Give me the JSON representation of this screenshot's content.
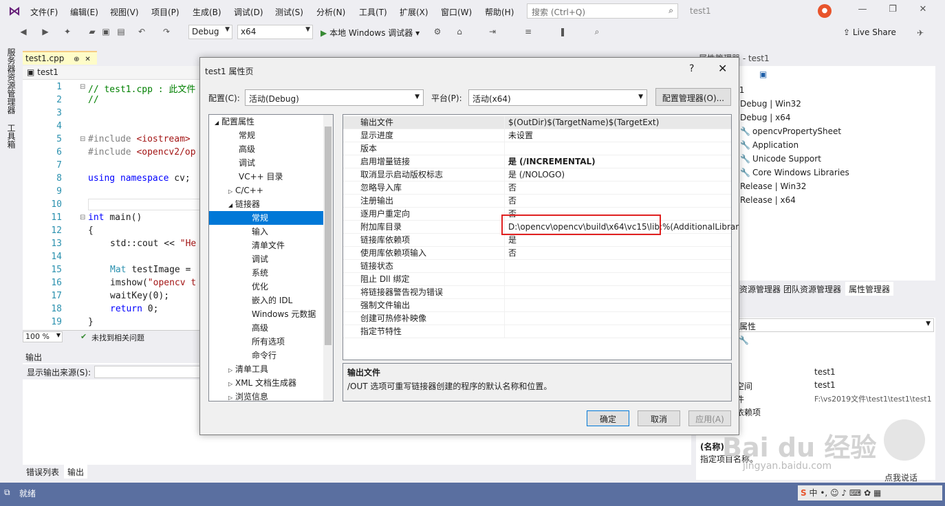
{
  "menubar": {
    "items": [
      "文件(F)",
      "编辑(E)",
      "视图(V)",
      "项目(P)",
      "生成(B)",
      "调试(D)",
      "测试(S)",
      "分析(N)",
      "工具(T)",
      "扩展(X)",
      "窗口(W)",
      "帮助(H)"
    ],
    "search_placeholder": "搜索 (Ctrl+Q)",
    "project_title": "test1"
  },
  "toolbar": {
    "config": "Debug",
    "platform": "x64",
    "run_label": "本地 Windows 调试器",
    "live_share": "Live Share"
  },
  "left_strip": {
    "tab1": "服务器资源管理器",
    "tab2": "工具箱"
  },
  "editor": {
    "tab_label": "test1.cpp",
    "breadcrumb": "test1",
    "line_numbers": [
      "1",
      "2",
      "3",
      "4",
      "5",
      "6",
      "7",
      "8",
      "9",
      "10",
      "11",
      "12",
      "13",
      "14",
      "15",
      "16",
      "17",
      "18",
      "19"
    ],
    "lines": {
      "l1_cm": "// test1.cpp : 此文件",
      "l2_cm": "//",
      "l5_kw": "#include",
      "l5_str": "<iostream>",
      "l6_kw": "#include",
      "l6_str": "<opencv2/op",
      "l8_kw1": "using",
      "l8_kw2": "namespace",
      "l8_rest": "cv;",
      "l11_kw": "int",
      "l11_rest": "main()",
      "l12": "{",
      "l13_a": "std::cout",
      "l13_b": "<<",
      "l13_str": "\"He",
      "l15_ty": "Mat",
      "l15_rest": "testImage =",
      "l16_fn": "imshow(",
      "l16_str": "\"opencv t",
      "l17": "waitKey(0);",
      "l18_kw": "return",
      "l18_rest": "0;",
      "l19": "}"
    },
    "zoom": "100 %",
    "issues": "未找到相关问题"
  },
  "output": {
    "title": "输出",
    "source_label": "显示输出来源(S):",
    "tabs": [
      "错误列表",
      "输出"
    ]
  },
  "prop_manager": {
    "title": "属性管理器 - test1",
    "tree_root": "t1",
    "tree": [
      "Debug | Win32",
      "Debug | x64",
      "opencvPropertySheet",
      "Application",
      "Unicode Support",
      "Core Windows Libraries",
      "Release | Win32",
      "Release | x64"
    ],
    "tabs": [
      "资源管理器",
      "团队资源管理器",
      "属性管理器"
    ]
  },
  "properties_panel": {
    "header": "属性",
    "rows": [
      {
        "name": "",
        "value": "test1"
      },
      {
        "name": "空间",
        "value": "test1"
      },
      {
        "name": "件",
        "value": "F:\\vs2019文件\\test1\\test1\\test1"
      },
      {
        "name": "依赖项",
        "value": ""
      }
    ],
    "desc_title": "(名称)",
    "desc_text": "指定项目名称。"
  },
  "dialog": {
    "title": "test1 属性页",
    "help": "?",
    "config_label": "配置(C):",
    "config_value": "活动(Debug)",
    "platform_label": "平台(P):",
    "platform_value": "活动(x64)",
    "config_manager": "配置管理器(O)...",
    "tree": [
      {
        "label": "配置属性",
        "expander": "◢"
      },
      {
        "label": "常规",
        "expander": ""
      },
      {
        "label": "高级",
        "expander": ""
      },
      {
        "label": "调试",
        "expander": ""
      },
      {
        "label": "VC++ 目录",
        "expander": ""
      },
      {
        "label": "C/C++",
        "expander": "▷"
      },
      {
        "label": "链接器",
        "expander": "◢"
      },
      {
        "label": "常规",
        "expander": ""
      },
      {
        "label": "输入",
        "expander": ""
      },
      {
        "label": "清单文件",
        "expander": ""
      },
      {
        "label": "调试",
        "expander": ""
      },
      {
        "label": "系统",
        "expander": ""
      },
      {
        "label": "优化",
        "expander": ""
      },
      {
        "label": "嵌入的 IDL",
        "expander": ""
      },
      {
        "label": "Windows 元数据",
        "expander": ""
      },
      {
        "label": "高级",
        "expander": ""
      },
      {
        "label": "所有选项",
        "expander": ""
      },
      {
        "label": "命令行",
        "expander": ""
      },
      {
        "label": "清单工具",
        "expander": "▷"
      },
      {
        "label": "XML 文档生成器",
        "expander": "▷"
      },
      {
        "label": "浏览信息",
        "expander": "▷"
      }
    ],
    "grid": [
      {
        "name": "输出文件",
        "value": "$(OutDir)$(TargetName)$(TargetExt)"
      },
      {
        "name": "显示进度",
        "value": "未设置"
      },
      {
        "name": "版本",
        "value": ""
      },
      {
        "name": "启用增量链接",
        "value": "是 (/INCREMENTAL)"
      },
      {
        "name": "取消显示启动版权标志",
        "value": "是 (/NOLOGO)"
      },
      {
        "name": "忽略导入库",
        "value": "否"
      },
      {
        "name": "注册输出",
        "value": "否"
      },
      {
        "name": "逐用户重定向",
        "value": "否"
      },
      {
        "name": "附加库目录",
        "value": "D:\\opencv\\opencv\\build\\x64\\vc15\\lib;%(AdditionalLibrar"
      },
      {
        "name": "链接库依赖项",
        "value": "是"
      },
      {
        "name": "使用库依赖项输入",
        "value": "否"
      },
      {
        "name": "链接状态",
        "value": ""
      },
      {
        "name": "阻止 Dll 绑定",
        "value": ""
      },
      {
        "name": "将链接器警告视为错误",
        "value": ""
      },
      {
        "name": "强制文件输出",
        "value": ""
      },
      {
        "name": "创建可热修补映像",
        "value": ""
      },
      {
        "name": "指定节特性",
        "value": ""
      }
    ],
    "desc_title": "输出文件",
    "desc_text": "/OUT 选项可重写链接器创建的程序的默认名称和位置。",
    "ok": "确定",
    "cancel": "取消",
    "apply": "应用(A)"
  },
  "statusbar": {
    "text": "就绪"
  },
  "watermark": {
    "logo": "Bai du 经验",
    "url": "jingyan.baidu.com",
    "speak": "点我说话"
  },
  "tray": {
    "ime": "中"
  },
  "colors": {
    "accent": "#0078d7",
    "highlight": "#e02020",
    "status": "#5a6fa0"
  }
}
